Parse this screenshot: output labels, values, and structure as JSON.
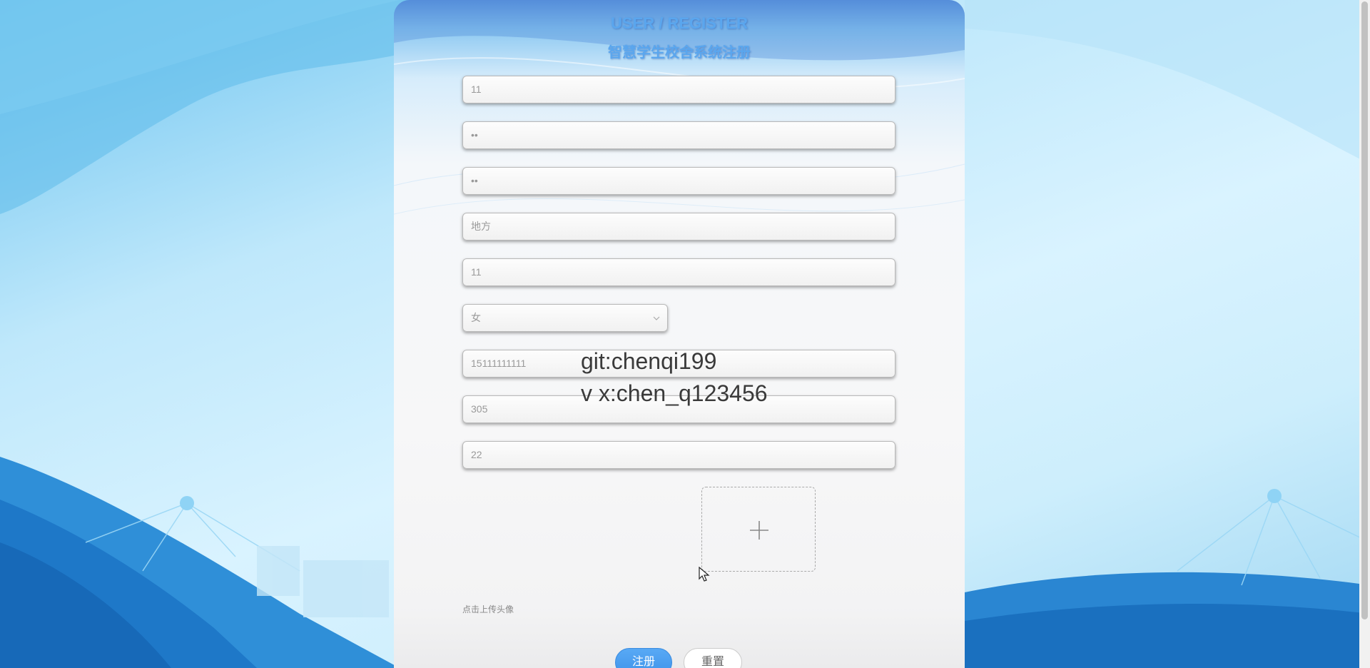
{
  "header": {
    "title_en": "USER / REGISTER",
    "title_cn": "智慧学生校舍系统注册"
  },
  "form": {
    "fields": [
      {
        "name": "account",
        "value": "11"
      },
      {
        "name": "password",
        "value": "••"
      },
      {
        "name": "confirm-password",
        "value": "••"
      },
      {
        "name": "address",
        "value": "地方"
      },
      {
        "name": "name",
        "value": "11"
      },
      {
        "name": "gender",
        "value": "女"
      },
      {
        "name": "phone",
        "value": "15111111111"
      },
      {
        "name": "dorm",
        "value": "305"
      },
      {
        "name": "age",
        "value": "22"
      }
    ],
    "upload_hint": "点击上传头像",
    "register_label": "注册",
    "reset_label": "重置"
  },
  "watermark": {
    "line1": "git:chenqi199",
    "line2": "v x:chen_q123456"
  },
  "icons": {
    "upload": "plus-icon",
    "select_arrow": "chevron-down-icon",
    "cursor": "mouse-pointer-icon"
  },
  "colors": {
    "accent": "#409eff",
    "title": "#5aa6ee"
  }
}
